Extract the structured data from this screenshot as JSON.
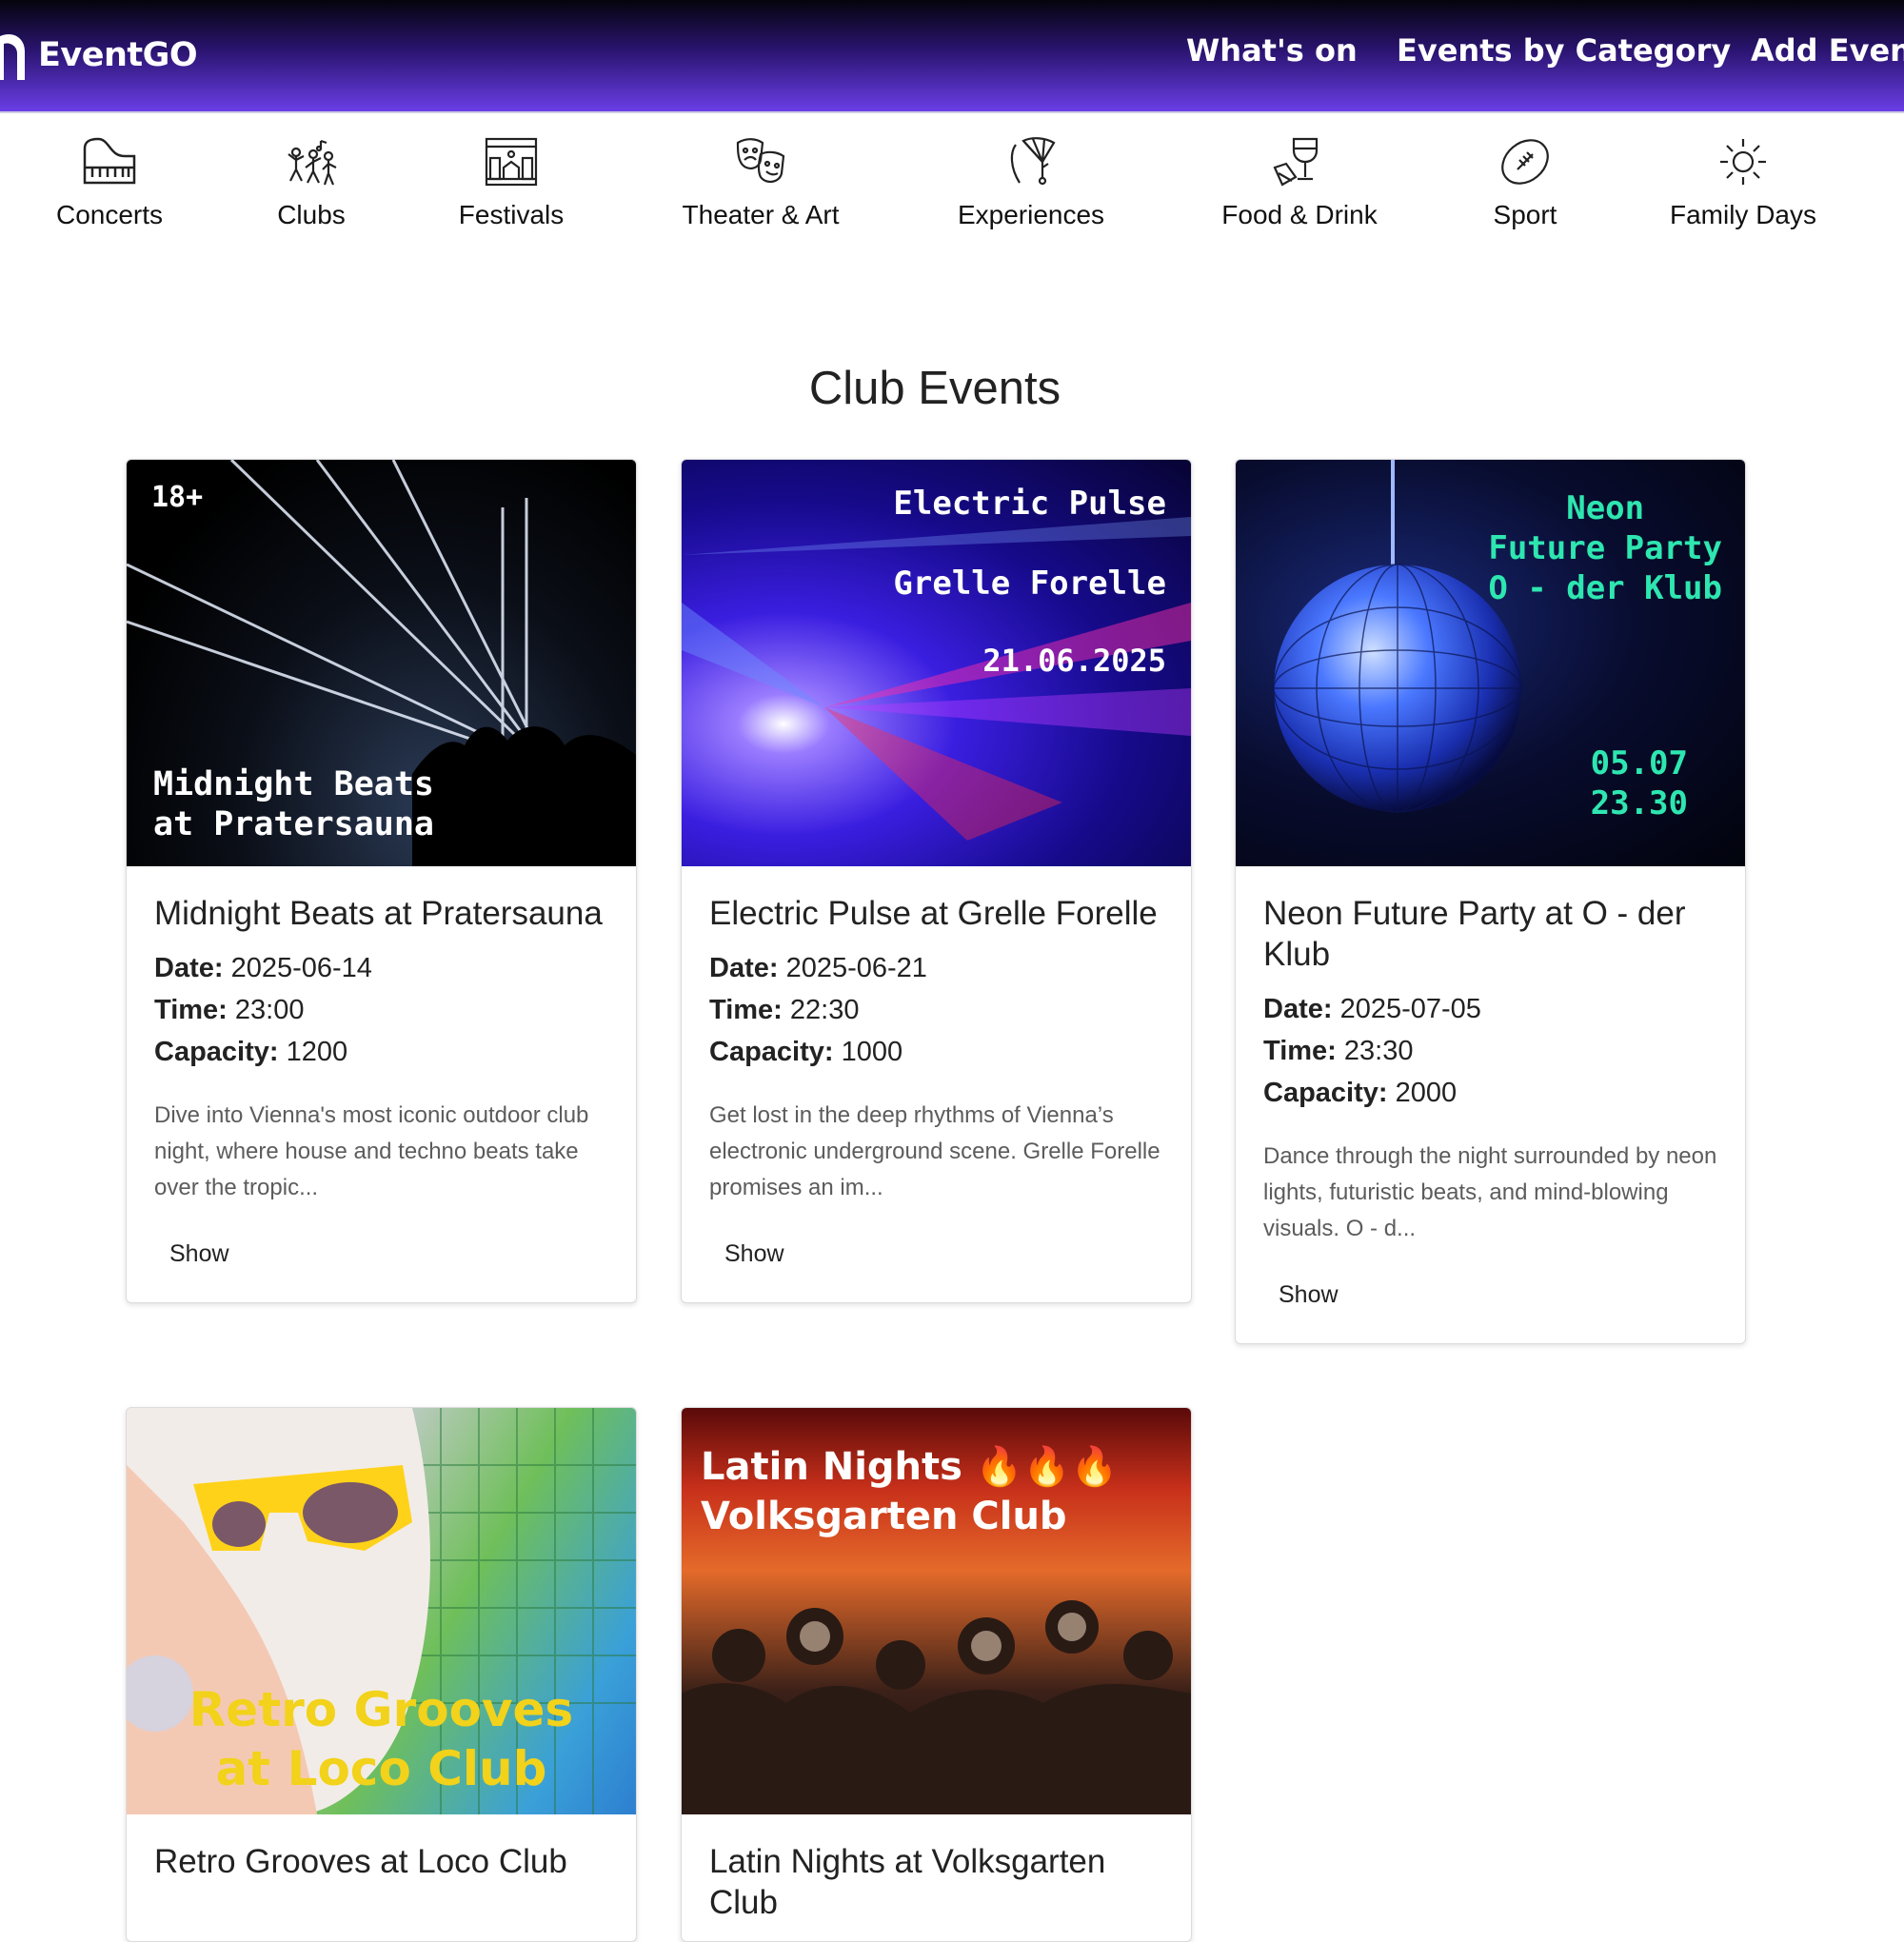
{
  "brand": {
    "name": "EventGO"
  },
  "nav": {
    "whats_on": "What's on",
    "by_category": "Events by Category",
    "add_event": "Add Event"
  },
  "categories": [
    {
      "label": "Concerts",
      "icon": "piano-icon"
    },
    {
      "label": "Clubs",
      "icon": "dancers-icon"
    },
    {
      "label": "Festivals",
      "icon": "stage-icon"
    },
    {
      "label": "Theater & Art",
      "icon": "theater-masks-icon"
    },
    {
      "label": "Experiences",
      "icon": "skydive-icon"
    },
    {
      "label": "Food & Drink",
      "icon": "wine-glass-icon"
    },
    {
      "label": "Sport",
      "icon": "football-icon"
    },
    {
      "label": "Family Days",
      "icon": "sun-icon"
    }
  ],
  "page": {
    "title": "Club Events"
  },
  "labels": {
    "date": "Date:",
    "time": "Time:",
    "capacity": "Capacity:",
    "show": "Show"
  },
  "events": [
    {
      "title": "Midnight Beats at Pratersauna",
      "date": "2025-06-14",
      "time": "23:00",
      "capacity": "1200",
      "description": "Dive into Vienna's most iconic outdoor club night, where house and techno beats take over the tropic...",
      "poster": {
        "badge": "18+",
        "text": "Midnight Beats\nat Pratersauna"
      }
    },
    {
      "title": "Electric Pulse at Grelle Forelle",
      "date": "2025-06-21",
      "time": "22:30",
      "capacity": "1000",
      "description": "Get lost in the deep rhythms of Vienna’s electronic underground scene. Grelle Forelle promises an im...",
      "poster": {
        "line1": "Electric Pulse",
        "line2": "Grelle Forelle",
        "line3": "21.06.2025"
      }
    },
    {
      "title": "Neon Future Party at O - der Klub",
      "date": "2025-07-05",
      "time": "23:30",
      "capacity": "2000",
      "description": "Dance through the night surrounded by neon lights, futuristic beats, and mind-blowing visuals. O - d...",
      "poster": {
        "text": "Neon\nFuture Party\nO - der Klub",
        "datetime": "05.07\n23.30"
      }
    },
    {
      "title": "Retro Grooves at Loco Club",
      "poster": {
        "text": "Retro Grooves\nat Loco Club"
      }
    },
    {
      "title": "Latin Nights at Volksgarten Club",
      "poster": {
        "text": "Latin Nights 🔥🔥🔥\nVolksgarten Club"
      }
    }
  ],
  "colors": {
    "nav_top": "#05040c",
    "nav_bottom": "#6a3ee6",
    "neon_text": "#2ee6b0",
    "retro_text": "#f2d21a"
  }
}
